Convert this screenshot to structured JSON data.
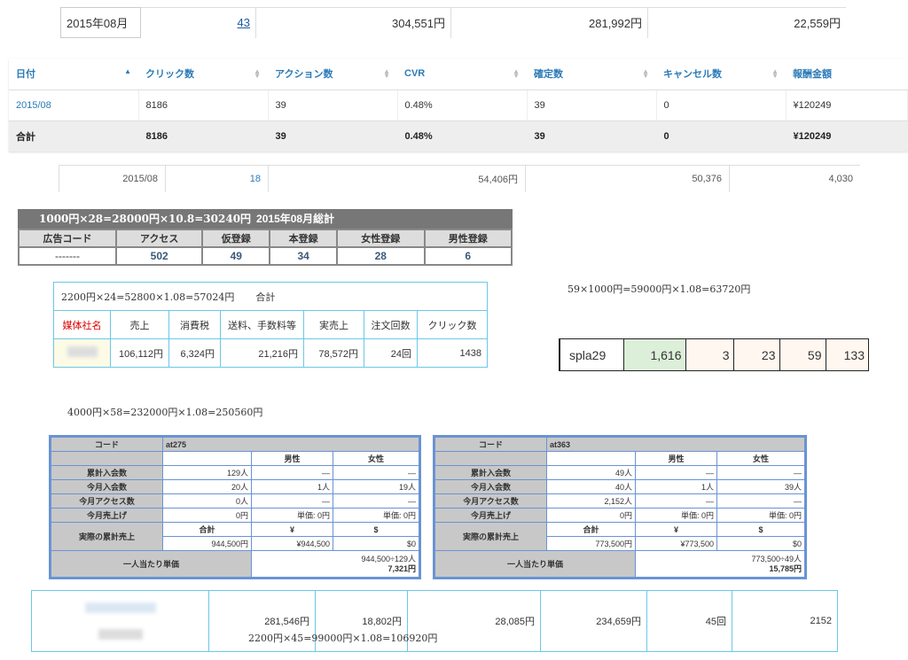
{
  "block1": {
    "month": "2015年08月",
    "link": "43",
    "v1": "304,551円",
    "v2": "281,992円",
    "v3": "22,559円"
  },
  "block2": {
    "headers": [
      "日付",
      "クリック数",
      "アクション数",
      "CVR",
      "確定数",
      "キャンセル数",
      "報酬金額"
    ],
    "row": [
      "2015/08",
      "8186",
      "39",
      "0.48%",
      "39",
      "0",
      "¥120249"
    ],
    "total": [
      "合計",
      "8186",
      "39",
      "0.48%",
      "39",
      "0",
      "¥120249"
    ]
  },
  "block3": {
    "date": "2015/08",
    "link": "18",
    "v1": "54,406円",
    "v2": "50,376",
    "v3": "4,030"
  },
  "block4": {
    "formula": "1000円×28=28000円×10.8=30240円",
    "title": "2015年08月総計",
    "headers": [
      "広告コード",
      "アクセス",
      "仮登録",
      "本登録",
      "女性登録",
      "男性登録"
    ],
    "values": [
      "-------",
      "502",
      "49",
      "34",
      "28",
      "6"
    ]
  },
  "block5": {
    "formula": "2200円×24=52800×1.08=57024円",
    "sum_label": "合計",
    "headers": [
      "媒体社名",
      "売上",
      "消費税",
      "送料、手数料等",
      "実売上",
      "注文回数",
      "クリック数"
    ],
    "values": [
      "106,112円",
      "6,324円",
      "21,216円",
      "78,572円",
      "24回",
      "1438"
    ]
  },
  "block6": {
    "formula": "59×1000円=59000円×1.08=63720円",
    "values": [
      "spla29",
      "1,616",
      "3",
      "23",
      "59",
      "133"
    ]
  },
  "block7_formula": "4000円×58=232000円×1.08=250560円",
  "at1": {
    "code_label": "コード",
    "code": "at275",
    "male": "男性",
    "female": "女性",
    "rows": [
      {
        "label": "累計入会数",
        "v": "129人",
        "m": "—",
        "f": "—"
      },
      {
        "label": "今月入会数",
        "v": "20人",
        "m": "1人",
        "f": "19人"
      },
      {
        "label": "今月アクセス数",
        "v": "0人",
        "m": "—",
        "f": "—"
      },
      {
        "label": "今月売上げ",
        "v": "0円",
        "m": "単価: 0円",
        "f": "単価: 0円"
      }
    ],
    "actual_label": "実際の累計売上",
    "sum": "合計",
    "yen": "¥",
    "usd": "$",
    "actual_sum": "944,500円",
    "actual_yen": "¥944,500",
    "actual_usd": "$0",
    "per_label": "一人当たり単価",
    "per_formula": "944,500÷129人",
    "per_value": "7,321円"
  },
  "at2": {
    "code_label": "コード",
    "code": "at363",
    "male": "男性",
    "female": "女性",
    "rows": [
      {
        "label": "累計入会数",
        "v": "49人",
        "m": "—",
        "f": "—"
      },
      {
        "label": "今月入会数",
        "v": "40人",
        "m": "1人",
        "f": "39人"
      },
      {
        "label": "今月アクセス数",
        "v": "2,152人",
        "m": "—",
        "f": "—"
      },
      {
        "label": "今月売上げ",
        "v": "0円",
        "m": "単価: 0円",
        "f": "単価: 0円"
      }
    ],
    "actual_label": "実際の累計売上",
    "sum": "合計",
    "yen": "¥",
    "usd": "$",
    "actual_sum": "773,500円",
    "actual_yen": "¥773,500",
    "actual_usd": "$0",
    "per_label": "一人当たり単価",
    "per_formula": "773,500÷49人",
    "per_value": "15,785円"
  },
  "bottom": {
    "values": [
      "281,546円",
      "18,802円",
      "28,085円",
      "234,659円",
      "45回",
      "2152"
    ],
    "formula": "2200円×45=99000円×1.08=106920円"
  }
}
